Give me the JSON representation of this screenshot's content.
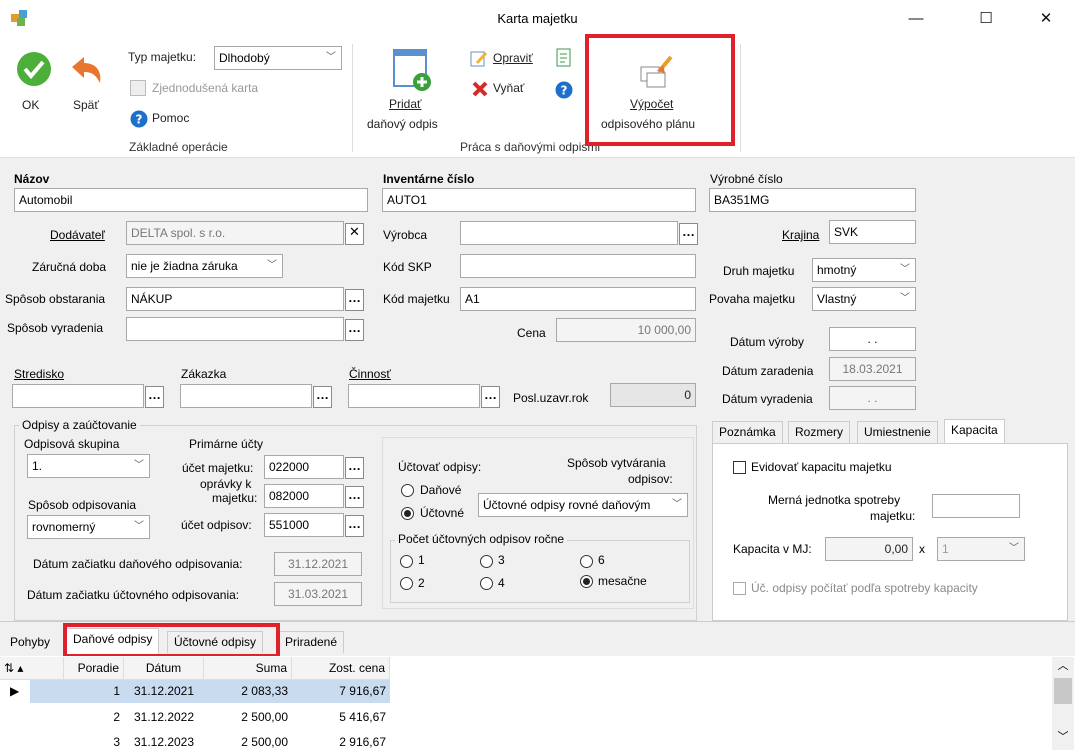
{
  "window": {
    "title": "Karta majetku",
    "minimize": "—",
    "maximize": "☐",
    "close": "✕"
  },
  "ribbon": {
    "ok": "OK",
    "back": "Späť",
    "typ_label": "Typ majetku:",
    "typ_value": "Dlhodobý",
    "simplified": "Zjednodušená karta",
    "help": "Pomoc",
    "group1": "Základné operácie",
    "add_line1": "Pridať",
    "add_line2": "daňový odpis",
    "edit": "Opraviť",
    "remove": "Vyňať",
    "group2": "Práca s daňovými odpismi",
    "calc_line1": "Výpočet",
    "calc_line2": "odpisového plánu"
  },
  "form": {
    "nazov_label": "Názov",
    "nazov": "Automobil",
    "inv_label": "Inventárne číslo",
    "inv": "AUTO1",
    "vyr_label": "Výrobné číslo",
    "vyr": "BA351MG",
    "dodavatel_label": "Dodávateľ",
    "dodavatel": "DELTA spol. s r.o.",
    "vyrobca_label": "Výrobca",
    "vyrobca": "",
    "krajina_label": "Krajina",
    "krajina": "SVK",
    "zarucna_label": "Záručná doba",
    "zarucna": "nie je žiadna záruka",
    "skp_label": "Kód SKP",
    "skp": "",
    "druh_label": "Druh majetku",
    "druh": "hmotný",
    "obstaranie_label": "Spôsob obstarania",
    "obstaranie": "NÁKUP",
    "kod_label": "Kód majetku",
    "kod": "A1",
    "povaha_label": "Povaha majetku",
    "povaha": "Vlastný",
    "vyradenie_label": "Spôsob vyradenia",
    "vyradenie": "",
    "cena_label": "Cena",
    "cena": "10 000,00",
    "datum_vyroby_label": "Dátum výroby",
    "datum_vyroby": ". .",
    "stredisko_label": "Stredisko",
    "zakazka_label": "Zákazka",
    "cinnost_label": "Činnosť",
    "datum_zaradenia_label": "Dátum zaradenia",
    "datum_zaradenia": "18.03.2021",
    "posl_label": "Posl.uzavr.rok",
    "posl": "0",
    "datum_vyradenia_label": "Dátum vyradenia",
    "datum_vyradenia": ". ."
  },
  "odpisy": {
    "title": "Odpisy a zaúčtovanie",
    "skupina_label": "Odpisová skupina",
    "skupina": "1.",
    "sposob_label": "Spôsob odpisovania",
    "sposob": "rovnomerný",
    "primarne": "Primárne účty",
    "ucet_majetku_label": "účet majetku:",
    "ucet_majetku": "022000",
    "opravky_label1": "oprávky k",
    "opravky_label2": "majetku:",
    "opravky": "082000",
    "ucet_odpisov_label": "účet odpisov:",
    "ucet_odpisov": "551000",
    "datum_danoveho_label": "Dátum začiatku daňového odpisovania:",
    "datum_danoveho": "31.12.2021",
    "datum_uctovneho_label": "Dátum začiatku účtovného odpisovania:",
    "datum_uctovneho": "31.03.2021",
    "uctovat_label": "Účtovať odpisy:",
    "danove": "Daňové",
    "uctovne": "Účtovné",
    "sposob_vytvarania1": "Spôsob vytvárania",
    "sposob_vytvarania2": "odpisov:",
    "sposob_vytvarania": "Účtovné odpisy rovné daňovým",
    "pocet_label": "Počet účtovných odpisov ročne",
    "r1": "1",
    "r2": "2",
    "r3": "3",
    "r4": "4",
    "r6": "6",
    "rm": "mesačne"
  },
  "right_tabs": {
    "tabs": [
      "Poznámka",
      "Rozmery",
      "Umiestnenie",
      "Kapacita"
    ],
    "evidovat": "Evidovať kapacitu majetku",
    "merna1": "Merná jednotka spotreby",
    "merna2": "majetku:",
    "kapacita_label": "Kapacita v MJ:",
    "kapacita": "0,00",
    "x": "x",
    "kapacita_unit": "1",
    "uc_odpisy": "Úč. odpisy počítať podľa spotreby kapacity"
  },
  "bottom_tabs": [
    "Pohyby",
    "Daňové odpisy",
    "Účtovné odpisy",
    "Priradené"
  ],
  "grid": {
    "headers": [
      "Poradie",
      "Dátum",
      "Suma",
      "Zost. cena"
    ],
    "rows": [
      [
        "1",
        "31.12.2021",
        "2 083,33",
        "7 916,67"
      ],
      [
        "2",
        "31.12.2022",
        "2 500,00",
        "5 416,67"
      ],
      [
        "3",
        "31.12.2023",
        "2 500,00",
        "2 916,67"
      ]
    ]
  },
  "colors": {
    "accent": "#e0202a",
    "ok_green": "#4caf3a",
    "selected_row": "#c9dbee"
  }
}
